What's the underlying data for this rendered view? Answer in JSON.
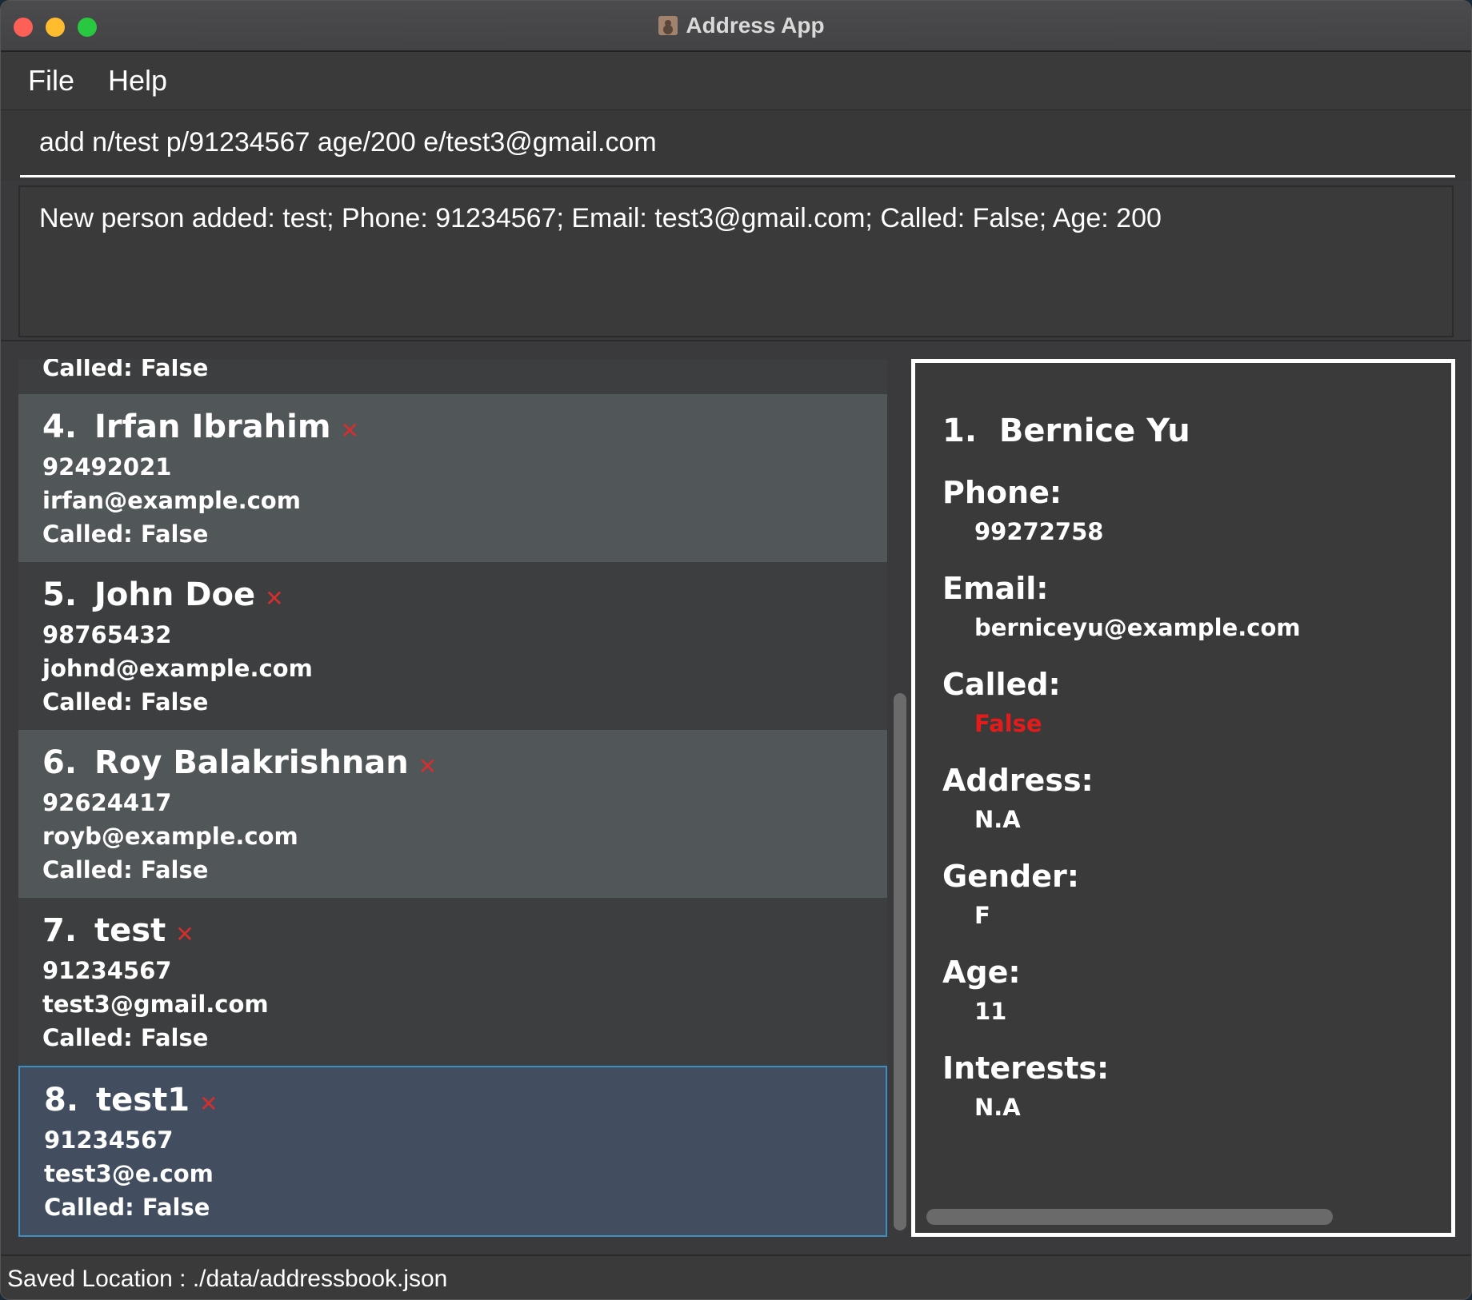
{
  "window": {
    "title": "Address App",
    "icon": "address-book-icon"
  },
  "menu": {
    "file": "File",
    "help": "Help"
  },
  "command": {
    "value": "add n/test p/91234567 age/200 e/test3@gmail.com"
  },
  "result": {
    "text": "New person added: test; Phone: 91234567; Email: test3@gmail.com; Called: False; Age: 200"
  },
  "list": {
    "partial_top": {
      "called": "Called: False"
    },
    "cards": [
      {
        "index": "4.",
        "name": "Irfan Ibrahim",
        "phone": "92492021",
        "email": "irfan@example.com",
        "called": "Called: False"
      },
      {
        "index": "5.",
        "name": "John Doe",
        "phone": "98765432",
        "email": "johnd@example.com",
        "called": "Called: False"
      },
      {
        "index": "6.",
        "name": "Roy Balakrishnan",
        "phone": "92624417",
        "email": "royb@example.com",
        "called": "Called: False"
      },
      {
        "index": "7.",
        "name": "test",
        "phone": "91234567",
        "email": "test3@gmail.com",
        "called": "Called: False"
      },
      {
        "index": "8.",
        "name": "test1",
        "phone": "91234567",
        "email": "test3@e.com",
        "called": "Called: False"
      }
    ]
  },
  "detail": {
    "index": "1.",
    "name": "Bernice Yu",
    "phone_label": "Phone:",
    "phone": "99272758",
    "email_label": "Email:",
    "email": "berniceyu@example.com",
    "called_label": "Called:",
    "called": "False",
    "address_label": "Address:",
    "address": "N.A",
    "gender_label": "Gender:",
    "gender": "F",
    "age_label": "Age:",
    "age": "11",
    "interests_label": "Interests:",
    "interests": "N.A"
  },
  "status": {
    "saved_location": "Saved Location : ./data/addressbook.json"
  },
  "colors": {
    "accent_selected_border": "#3d8fc1",
    "delete_icon": "#d32f2f",
    "false_value": "#e31b1b"
  }
}
